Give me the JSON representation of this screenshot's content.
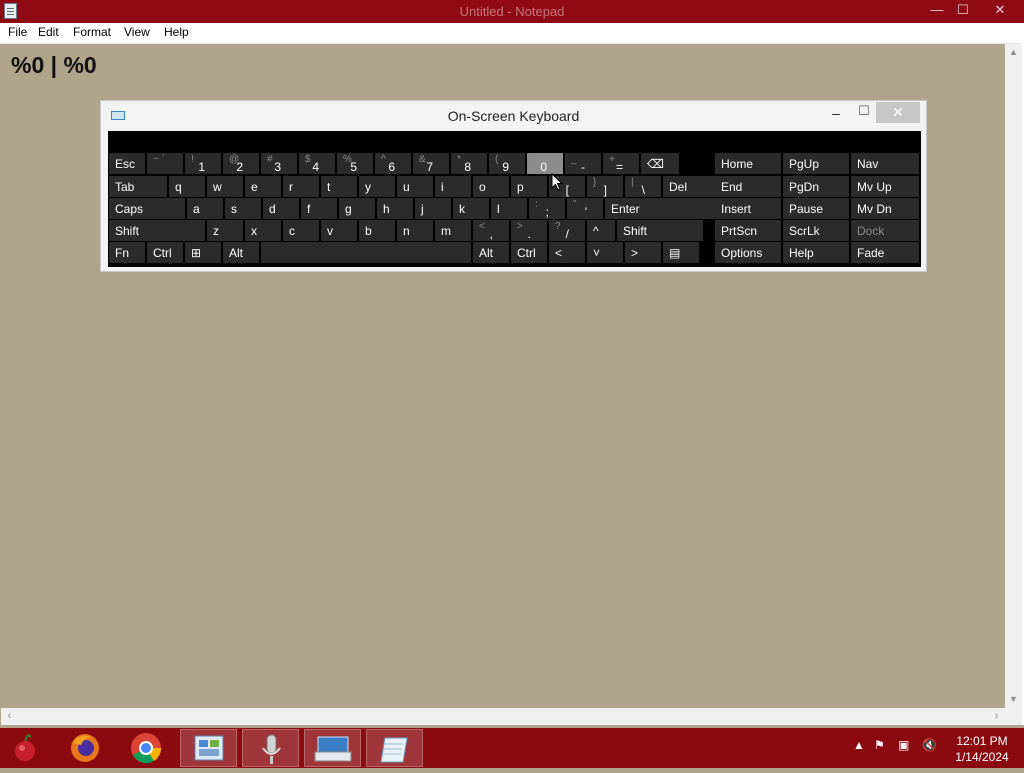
{
  "window": {
    "title": "Untitled - Notepad",
    "controls": {
      "minimize": "—",
      "maximize": "☐",
      "close": "✕"
    }
  },
  "menu": [
    "File",
    "Edit",
    "Format",
    "View",
    "Help"
  ],
  "document": {
    "text": "%0 | %0"
  },
  "osk": {
    "title": "On-Screen Keyboard",
    "controls": {
      "minimize": "–",
      "maximize": "☐",
      "close": "✕"
    },
    "pressed_key": "0",
    "rows": [
      [
        {
          "label": "Esc"
        },
        {
          "sub": "~",
          "sub2": "`"
        },
        {
          "sub": "!",
          "main": "1"
        },
        {
          "sub": "@",
          "main": "2"
        },
        {
          "sub": "#",
          "main": "3"
        },
        {
          "sub": "$",
          "main": "4"
        },
        {
          "sub": "%",
          "main": "5"
        },
        {
          "sub": "^",
          "main": "6"
        },
        {
          "sub": "&",
          "main": "7"
        },
        {
          "sub": "*",
          "main": "8"
        },
        {
          "sub": "(",
          "main": "9"
        },
        {
          "sub": ")",
          "main": "0"
        },
        {
          "sub": "_",
          "main": "-"
        },
        {
          "sub": "+",
          "main": "="
        },
        {
          "label": "⌫"
        }
      ],
      [
        {
          "label": "Tab"
        },
        {
          "label": "q"
        },
        {
          "label": "w"
        },
        {
          "label": "e"
        },
        {
          "label": "r"
        },
        {
          "label": "t"
        },
        {
          "label": "y"
        },
        {
          "label": "u"
        },
        {
          "label": "i"
        },
        {
          "label": "o"
        },
        {
          "label": "p"
        },
        {
          "sub": "{",
          "main": "["
        },
        {
          "sub": "}",
          "main": "]"
        },
        {
          "sub": "|",
          "main": "\\"
        },
        {
          "label": "Del"
        }
      ],
      [
        {
          "label": "Caps"
        },
        {
          "label": "a"
        },
        {
          "label": "s"
        },
        {
          "label": "d"
        },
        {
          "label": "f"
        },
        {
          "label": "g"
        },
        {
          "label": "h"
        },
        {
          "label": "j"
        },
        {
          "label": "k"
        },
        {
          "label": "l"
        },
        {
          "sub": ":",
          "main": ";"
        },
        {
          "sub": "\"",
          "main": "'"
        },
        {
          "label": "Enter"
        }
      ],
      [
        {
          "label": "Shift"
        },
        {
          "label": "z"
        },
        {
          "label": "x"
        },
        {
          "label": "c"
        },
        {
          "label": "v"
        },
        {
          "label": "b"
        },
        {
          "label": "n"
        },
        {
          "label": "m"
        },
        {
          "sub": "<",
          "main": ","
        },
        {
          "sub": ">",
          "main": "."
        },
        {
          "sub": "?",
          "main": "/"
        },
        {
          "label": "^"
        },
        {
          "label": "Shift"
        }
      ],
      [
        {
          "label": "Fn"
        },
        {
          "label": "Ctrl"
        },
        {
          "label": "⊞"
        },
        {
          "label": "Alt"
        },
        {
          "label": ""
        },
        {
          "label": "Alt"
        },
        {
          "label": "Ctrl"
        },
        {
          "label": "<"
        },
        {
          "label": "˅"
        },
        {
          "label": ">"
        },
        {
          "label": "▤"
        }
      ]
    ],
    "nav_keys": [
      [
        "Home",
        "PgUp",
        "Nav"
      ],
      [
        "End",
        "PgDn",
        "Mv Up"
      ],
      [
        "Insert",
        "Pause",
        "Mv Dn"
      ],
      [
        "PrtScn",
        "ScrLk",
        "Dock"
      ],
      [
        "Options",
        "Help",
        "Fade"
      ]
    ]
  },
  "taskbar": {
    "apps": [
      "fruit-logo-icon",
      "firefox-icon",
      "chrome-icon",
      "control-panel-icon",
      "microphone-icon",
      "on-screen-keyboard-icon",
      "notepad-icon"
    ],
    "tray_icons": [
      "show-hidden-icon",
      "flag-icon",
      "network-icon",
      "volume-muted-icon"
    ],
    "time": "12:01 PM",
    "date": "1/14/2024"
  }
}
